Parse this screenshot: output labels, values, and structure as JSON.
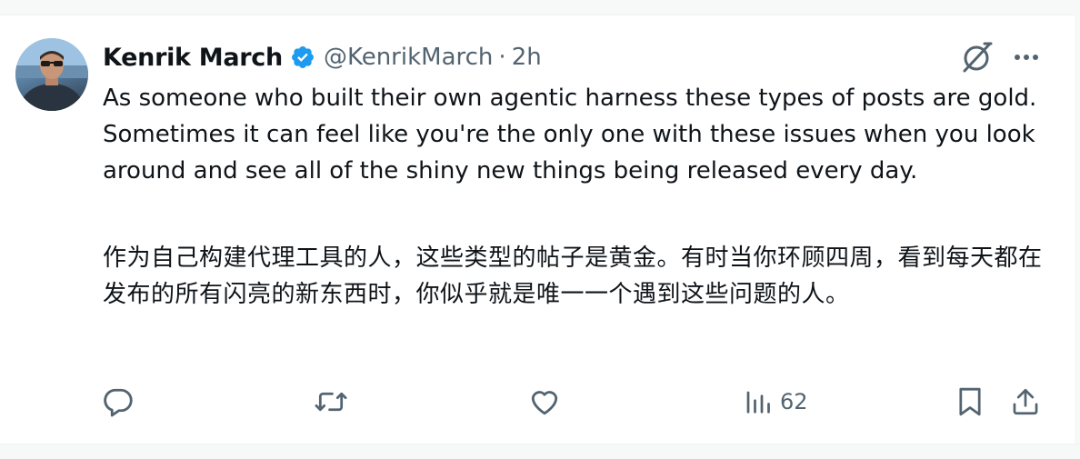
{
  "tweet": {
    "author": {
      "display_name": "Kenrik March",
      "handle": "@KenrikMarch",
      "verified": true
    },
    "separator": "·",
    "time": "2h",
    "text": "As someone who built their own agentic harness these types of posts are gold. Sometimes it can feel like you're the only one with these issues when you look around and see all of the shiny new things being released every day.",
    "translation": "作为自己构建代理工具的人，这些类型的帖子是黄金。有时当你环顾四周，看到每天都在发布的所有闪亮的新东西时，你似乎就是唯一一个遇到这些问题的人。"
  },
  "actions": {
    "reply_icon": "reply-icon",
    "retweet_icon": "retweet-icon",
    "like_icon": "heart-icon",
    "views_icon": "views-chart-icon",
    "views_count": "62",
    "bookmark_icon": "bookmark-icon",
    "share_icon": "share-icon"
  },
  "colors": {
    "text": "#0f1419",
    "secondary": "#536471",
    "verified": "#1d9bf0",
    "separator_bg": "#f7f9f9"
  }
}
